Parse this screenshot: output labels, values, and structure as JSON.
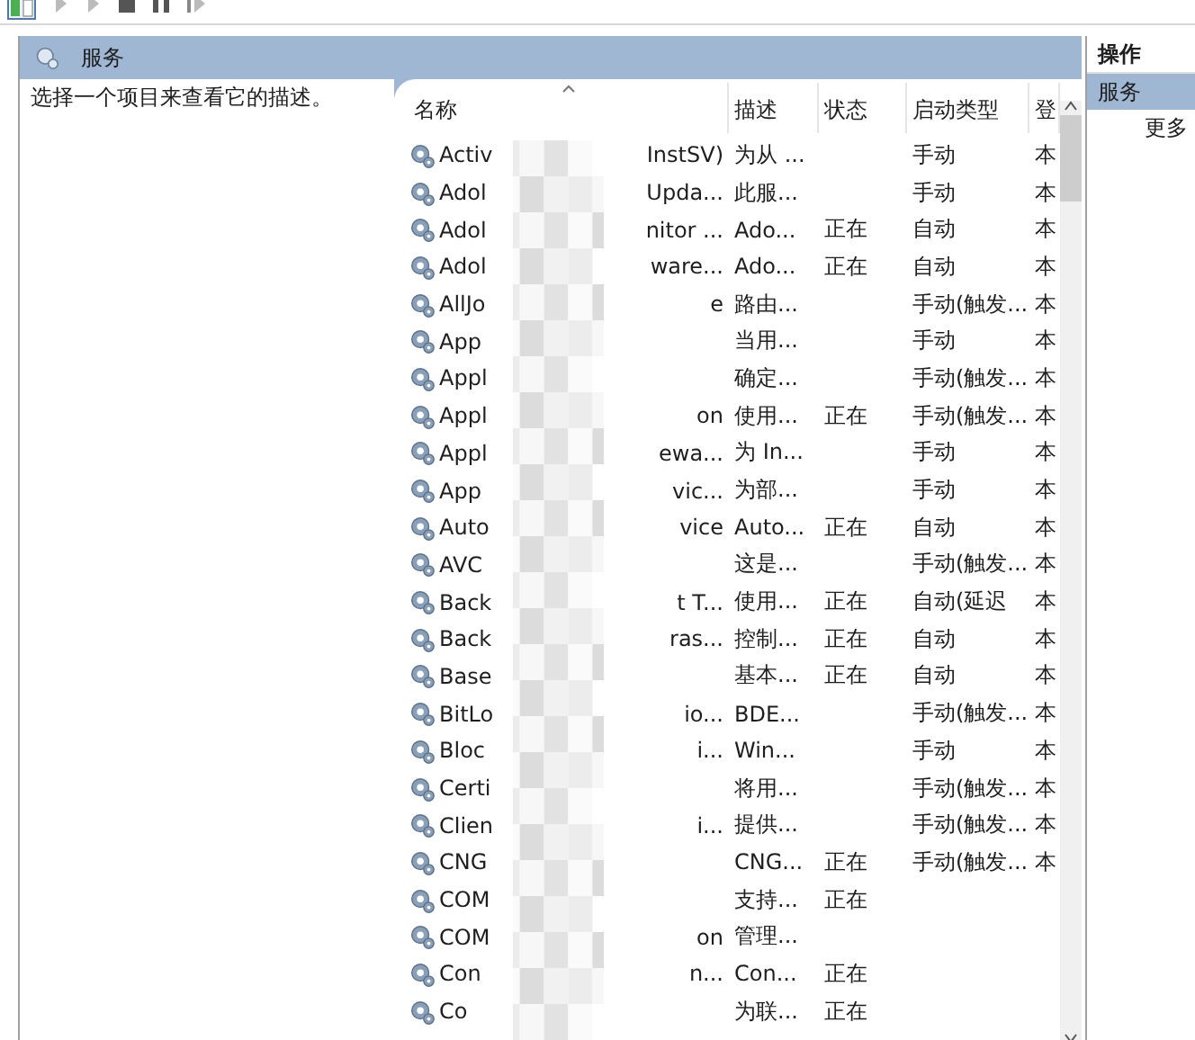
{
  "pane_header": {
    "title": "服务"
  },
  "description": "选择一个项目来查看它的描述。",
  "table": {
    "columns": [
      {
        "label": "名称",
        "sorted": true
      },
      {
        "label": "描述",
        "sorted": false
      },
      {
        "label": "状态",
        "sorted": false
      },
      {
        "label": "启动类型",
        "sorted": false
      },
      {
        "label": "登",
        "sorted": false
      }
    ],
    "rows": [
      {
        "name": "Activ",
        "name_tail": "InstSV)",
        "description": "为从 ...",
        "startup": "手动",
        "logon": "本"
      },
      {
        "name": "Adol",
        "name_tail": "Upda...",
        "description": "此服...",
        "startup": "手动",
        "logon": "本"
      },
      {
        "name": "Adol",
        "name_tail": "nitor ...",
        "description": "Ado...",
        "status": "正在",
        "startup": "自动",
        "logon": "本"
      },
      {
        "name": "Adol",
        "name_tail": "ware...",
        "description": "Ado...",
        "status": "正在",
        "startup": "自动",
        "logon": "本"
      },
      {
        "name": "AllJo",
        "name_tail": "e",
        "description": "路由...",
        "startup": "手动(触发...",
        "logon": "本"
      },
      {
        "name": "App",
        "description": "当用...",
        "startup": "手动",
        "logon": "本"
      },
      {
        "name": "Appl",
        "description": "确定...",
        "startup": "手动(触发...",
        "logon": "本"
      },
      {
        "name": "Appl",
        "name_tail": "on",
        "description": "使用...",
        "status": "正在",
        "startup": "手动(触发...",
        "logon": "本"
      },
      {
        "name": "Appl",
        "name_tail": "ewa...",
        "description": "为 In...",
        "startup": "手动",
        "logon": "本"
      },
      {
        "name": "App",
        "name_tail": "vic...",
        "description": "为部...",
        "startup": "手动",
        "logon": "本"
      },
      {
        "name": "Auto",
        "name_tail": "vice",
        "description": "Auto...",
        "status": "正在",
        "startup": "自动",
        "logon": "本"
      },
      {
        "name": "AVC",
        "description": "这是...",
        "startup": "手动(触发...",
        "logon": "本"
      },
      {
        "name": "Back",
        "name_tail": "t T...",
        "description": "使用...",
        "status": "正在",
        "startup": "自动(延迟",
        "logon": "本"
      },
      {
        "name": "Back",
        "name_tail": "ras...",
        "description": "控制...",
        "status": "正在",
        "startup": "自动",
        "logon": "本"
      },
      {
        "name": "Base",
        "description": "基本...",
        "status": "正在",
        "startup": "自动",
        "logon": "本"
      },
      {
        "name": "BitLo",
        "name_tail": "io...",
        "description": "BDE...",
        "startup": "手动(触发...",
        "logon": "本"
      },
      {
        "name": "Bloc",
        "name_tail": "i...",
        "description": "Win...",
        "startup": "手动",
        "logon": "本"
      },
      {
        "name": "Certi",
        "description": "将用...",
        "startup": "手动(触发...",
        "logon": "本"
      },
      {
        "name": "Clien",
        "name_tail": "i...",
        "description": "提供...",
        "startup": "手动(触发...",
        "logon": "本"
      },
      {
        "name": "CNG",
        "description": "CNG...",
        "status": "正在",
        "startup": "手动(触发...",
        "logon": "本"
      },
      {
        "name": "COM",
        "description": "支持...",
        "status": "正在"
      },
      {
        "name": "COM",
        "name_tail": "on",
        "description": "管理..."
      },
      {
        "name": "Con",
        "name_tail": "n...",
        "description": "Con...",
        "status": "正在"
      },
      {
        "name": "Co",
        "description": "为联...",
        "status": "正在"
      }
    ]
  },
  "actions": {
    "title": "操作",
    "items": [
      {
        "label": "服务",
        "selected": true
      },
      {
        "label": "更多",
        "selected": false
      }
    ]
  }
}
